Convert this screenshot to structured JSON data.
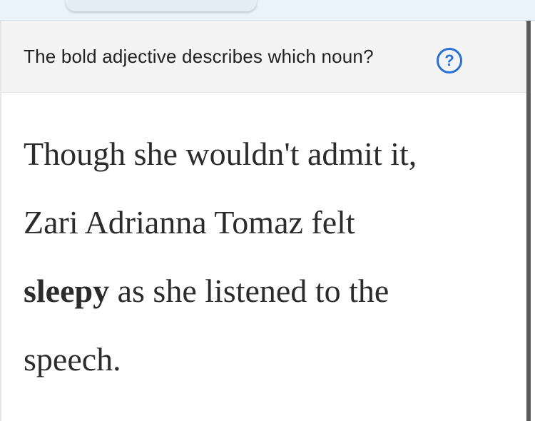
{
  "question": {
    "prompt": "The bold adjective describes which noun?",
    "help_icon": "question-circle-icon",
    "help_symbol": "?"
  },
  "passage": {
    "line1": "Though she wouldn't admit it,",
    "line2": "Zari Adrianna Tomaz felt",
    "line3_bold": "sleepy",
    "line3_rest": " as she listened to the",
    "line4": "speech."
  },
  "colors": {
    "accent": "#2b6fd6",
    "question_bg": "#f4f4f4",
    "top_strip": "#e9f3fb"
  }
}
